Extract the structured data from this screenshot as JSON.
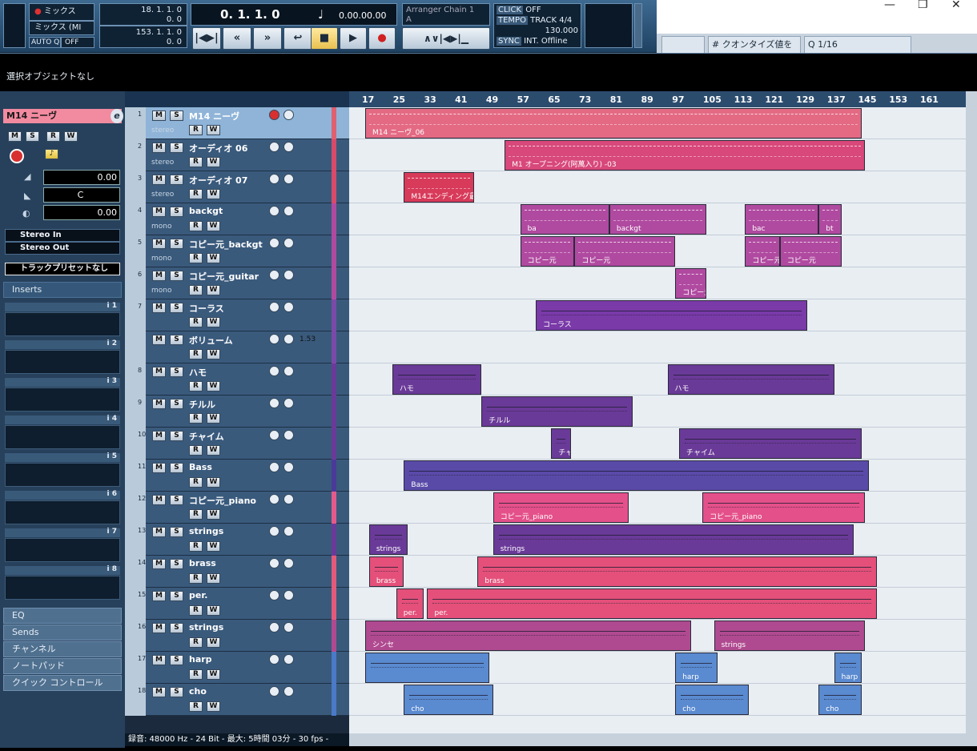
{
  "transport": {
    "mix_top": "ミックス",
    "mix_bottom": "ミックス (MI",
    "autoq_label": "AUTO Q",
    "autoq_value": "OFF",
    "left_locator": "18. 1. 1.   0",
    "left_offset": "0.   0",
    "right_locator": "153. 1. 1.   0",
    "right_offset": "0.   0",
    "primary_time": "0. 1. 1.   0",
    "secondary_time": "0.00.00.00",
    "arranger_chain": "Arranger Chain 1",
    "arranger_sub": "A",
    "click_label": "CLICK",
    "click_value": "OFF",
    "tempo_label": "TEMPO",
    "tempo_mode": "TRACK",
    "signature": "4/4",
    "tempo_value": "130.000",
    "sync_label": "SYNC",
    "sync_mode": "INT.",
    "sync_value": "Offline"
  },
  "toolbar": {
    "quantize_label": "クオンタイズ値を",
    "quantize_value": "1/16"
  },
  "info_line": "選択オブジェクトなし",
  "inspector": {
    "track_title": "M14 ニーヴ",
    "volume": "0.00",
    "pan": "C",
    "delay": "0.00",
    "input_routing": "Stereo In",
    "output_routing": "Stereo Out",
    "preset": "トラックプリセットなし",
    "inserts_label": "Inserts",
    "slot_labels": [
      "i 1",
      "i 2",
      "i 3",
      "i 4",
      "i 5",
      "i 6",
      "i 7",
      "i 8"
    ],
    "bottom_sections": [
      "EQ",
      "Sends",
      "チャンネル",
      "ノートパッド",
      "クイック コントロール"
    ]
  },
  "ruler_bars": [
    "17",
    "25",
    "33",
    "41",
    "49",
    "57",
    "65",
    "73",
    "81",
    "89",
    "97",
    "105",
    "113",
    "121",
    "129",
    "137",
    "145",
    "153",
    "161"
  ],
  "tracks": [
    {
      "num": "1",
      "name": "M14 ニーヴ",
      "sub": "stereo",
      "color": "#e06070"
    },
    {
      "num": "2",
      "name": "オーディオ 06",
      "sub": "stereo",
      "color": "#d84a6a"
    },
    {
      "num": "3",
      "name": "オーディオ 07",
      "sub": "stereo",
      "color": "#d84a6a"
    },
    {
      "num": "4",
      "name": "backgt",
      "sub": "mono",
      "color": "#b04aa0"
    },
    {
      "num": "5",
      "name": "コピー元_backgt",
      "sub": "mono",
      "color": "#b04aa0"
    },
    {
      "num": "6",
      "name": "コピー元_guitar",
      "sub": "mono",
      "color": "#b04aa0"
    },
    {
      "num": "7",
      "name": "コーラス",
      "sub": "",
      "color": "#7a4aa8"
    },
    {
      "num": "",
      "name": "ボリューム",
      "sub": "1.53",
      "color": "#7a4aa8"
    },
    {
      "num": "8",
      "name": "ハモ",
      "sub": "",
      "color": "#6a3a98"
    },
    {
      "num": "9",
      "name": "チルル",
      "sub": "",
      "color": "#6a3a98"
    },
    {
      "num": "10",
      "name": "チャイム",
      "sub": "",
      "color": "#6a3a98"
    },
    {
      "num": "11",
      "name": "Bass",
      "sub": "",
      "color": "#4a3a98"
    },
    {
      "num": "12",
      "name": "コピー元_piano",
      "sub": "",
      "color": "#e45a8a"
    },
    {
      "num": "13",
      "name": "strings",
      "sub": "",
      "color": "#6a3a98"
    },
    {
      "num": "14",
      "name": "brass",
      "sub": "",
      "color": "#e45a7a"
    },
    {
      "num": "15",
      "name": "per.",
      "sub": "",
      "color": "#e45a7a"
    },
    {
      "num": "16",
      "name": "strings",
      "sub": "",
      "color": "#b04a90"
    },
    {
      "num": "17",
      "name": "harp",
      "sub": "",
      "color": "#4a7ac8"
    },
    {
      "num": "18",
      "name": "cho",
      "sub": "",
      "color": "#4a7ac8"
    }
  ],
  "status_bar": "録音: 48000 Hz - 24 Bit - 最大: 5時間 03分 - 30 fps -",
  "parts": [
    {
      "lane": 0,
      "bar": 17,
      "end": 145,
      "label": "M14 ニーヴ_06",
      "kind": "wave",
      "color": "#e46a84"
    },
    {
      "lane": 1,
      "bar": 53,
      "end": 146,
      "label": "M1  オープニング(阿萬入り) -03",
      "kind": "wave",
      "color": "#d8487a"
    },
    {
      "lane": 2,
      "bar": 27,
      "end": 45,
      "label": "M14エンディング最初",
      "kind": "wave",
      "color": "#d83a5a"
    },
    {
      "lane": 3,
      "bar": 57,
      "end": 80,
      "label": "ba",
      "kind": "wave",
      "color": "#b04aa0"
    },
    {
      "lane": 3,
      "bar": 80,
      "end": 105,
      "label": "backgt",
      "kind": "wave",
      "color": "#b04aa0"
    },
    {
      "lane": 3,
      "bar": 115,
      "end": 134,
      "label": "bac",
      "kind": "wave",
      "color": "#b04aa0"
    },
    {
      "lane": 3,
      "bar": 134,
      "end": 140,
      "label": "bt",
      "kind": "wave",
      "color": "#b04aa0"
    },
    {
      "lane": 4,
      "bar": 57,
      "end": 71,
      "label": "コピー元",
      "kind": "wave",
      "color": "#b04aa0"
    },
    {
      "lane": 4,
      "bar": 71,
      "end": 97,
      "label": "コピー元",
      "kind": "wave",
      "color": "#b04aa0"
    },
    {
      "lane": 4,
      "bar": 115,
      "end": 124,
      "label": "コピー元",
      "kind": "wave",
      "color": "#b04aa0"
    },
    {
      "lane": 4,
      "bar": 124,
      "end": 140,
      "label": "コピー元",
      "kind": "wave",
      "color": "#b04aa0"
    },
    {
      "lane": 5,
      "bar": 97,
      "end": 105,
      "label": "コピー元",
      "kind": "wave",
      "color": "#b04aa0"
    },
    {
      "lane": 6,
      "bar": 61,
      "end": 131,
      "label": "コーラス",
      "kind": "midi",
      "color": "#7a3aa8"
    },
    {
      "lane": 8,
      "bar": 24,
      "end": 47,
      "label": "ハモ",
      "kind": "midi",
      "color": "#6a3a98"
    },
    {
      "lane": 8,
      "bar": 95,
      "end": 138,
      "label": "ハモ",
      "kind": "midi",
      "color": "#6a3a98"
    },
    {
      "lane": 9,
      "bar": 47,
      "end": 86,
      "label": "チルル",
      "kind": "midi",
      "color": "#6a3a98"
    },
    {
      "lane": 10,
      "bar": 65,
      "end": 70,
      "label": "チャ",
      "kind": "midi",
      "color": "#6a3a98"
    },
    {
      "lane": 10,
      "bar": 98,
      "end": 145,
      "label": "チャイム",
      "kind": "midi",
      "color": "#6a3a98"
    },
    {
      "lane": 11,
      "bar": 27,
      "end": 147,
      "label": "Bass",
      "kind": "midi",
      "color": "#5a4aa8"
    },
    {
      "lane": 12,
      "bar": 50,
      "end": 85,
      "label": "コピー元_piano",
      "kind": "midi",
      "color": "#e4508a"
    },
    {
      "lane": 12,
      "bar": 104,
      "end": 146,
      "label": "コピー元_piano",
      "kind": "midi",
      "color": "#e4508a"
    },
    {
      "lane": 13,
      "bar": 18,
      "end": 28,
      "label": "strings",
      "kind": "midi",
      "color": "#6a3a98"
    },
    {
      "lane": 13,
      "bar": 50,
      "end": 143,
      "label": "strings",
      "kind": "midi",
      "color": "#6a3a98"
    },
    {
      "lane": 14,
      "bar": 18,
      "end": 27,
      "label": "brass",
      "kind": "midi",
      "color": "#e4507a"
    },
    {
      "lane": 14,
      "bar": 46,
      "end": 149,
      "label": "brass",
      "kind": "midi",
      "color": "#e4507a"
    },
    {
      "lane": 15,
      "bar": 25,
      "end": 32,
      "label": "per.",
      "kind": "midi",
      "color": "#e4507a"
    },
    {
      "lane": 15,
      "bar": 33,
      "end": 149,
      "label": "per.",
      "kind": "midi",
      "color": "#e4507a"
    },
    {
      "lane": 16,
      "bar": 17,
      "end": 101,
      "label": "シンセ",
      "kind": "midi",
      "color": "#b04a90"
    },
    {
      "lane": 16,
      "bar": 107,
      "end": 146,
      "label": "strings",
      "kind": "midi",
      "color": "#b04a90"
    },
    {
      "lane": 17,
      "bar": 17,
      "end": 49,
      "label": "",
      "kind": "midi",
      "color": "#5a8ad0"
    },
    {
      "lane": 17,
      "bar": 97,
      "end": 108,
      "label": "harp",
      "kind": "midi",
      "color": "#5a8ad0"
    },
    {
      "lane": 17,
      "bar": 138,
      "end": 145,
      "label": "harp",
      "kind": "midi",
      "color": "#5a8ad0"
    },
    {
      "lane": 18,
      "bar": 27,
      "end": 50,
      "label": "cho",
      "kind": "midi",
      "color": "#5a8ad0"
    },
    {
      "lane": 18,
      "bar": 97,
      "end": 116,
      "label": "cho",
      "kind": "midi",
      "color": "#5a8ad0"
    },
    {
      "lane": 18,
      "bar": 134,
      "end": 145,
      "label": "cho",
      "kind": "midi",
      "color": "#5a8ad0"
    }
  ]
}
